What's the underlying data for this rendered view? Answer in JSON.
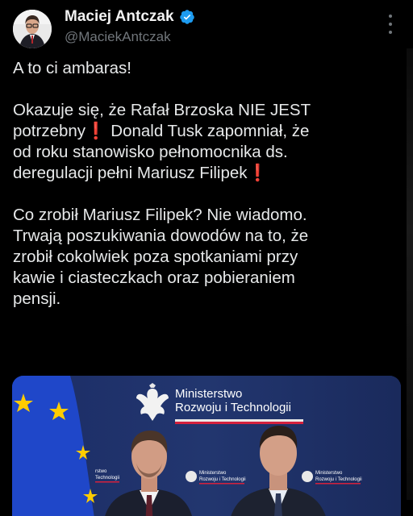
{
  "author": {
    "name": "Maciej Antczak",
    "handle": "@MaciekAntczak",
    "verified": true
  },
  "tweet": {
    "para1": "A to ci ambaras!",
    "para2_a": "Okazuje się, że Rafał Brzoska NIE JEST",
    "para2_b": "potrzebny",
    "para2_c": "Donald Tusk zapomniał, że",
    "para2_d": "od roku stanowisko pełnomocnika ds.",
    "para2_e": "deregulacji pełni Mariusz Filipek",
    "para3_a": "Co zrobił Mariusz Filipek? Nie wiadomo.",
    "para3_b": "Trwają poszukiwania dowodów na to, że",
    "para3_c": "zrobił cokolwiek poza spotkaniami przy",
    "para3_d": "kawie i ciasteczkach oraz pobieraniem",
    "para3_e": "pensji.",
    "exclamation": "❗"
  },
  "media": {
    "ministry_line1": "Ministerstwo",
    "ministry_line2": "Rozwoju i Technologii",
    "small_line1": "Ministerstwo",
    "small_line2": "Rozwoju i Technologii",
    "edge_text_a": "rstwo",
    "edge_text_b": "Technologii"
  },
  "colors": {
    "background": "#000000",
    "text": "#e7e9ea",
    "muted": "#71767b",
    "verified": "#1d9bf0",
    "exclamation": "#e0245e",
    "eu_blue": "#1f47c9",
    "eu_star": "#ffcc00"
  },
  "icons": {
    "verified": "verified-badge-icon",
    "more": "more-options-icon"
  }
}
